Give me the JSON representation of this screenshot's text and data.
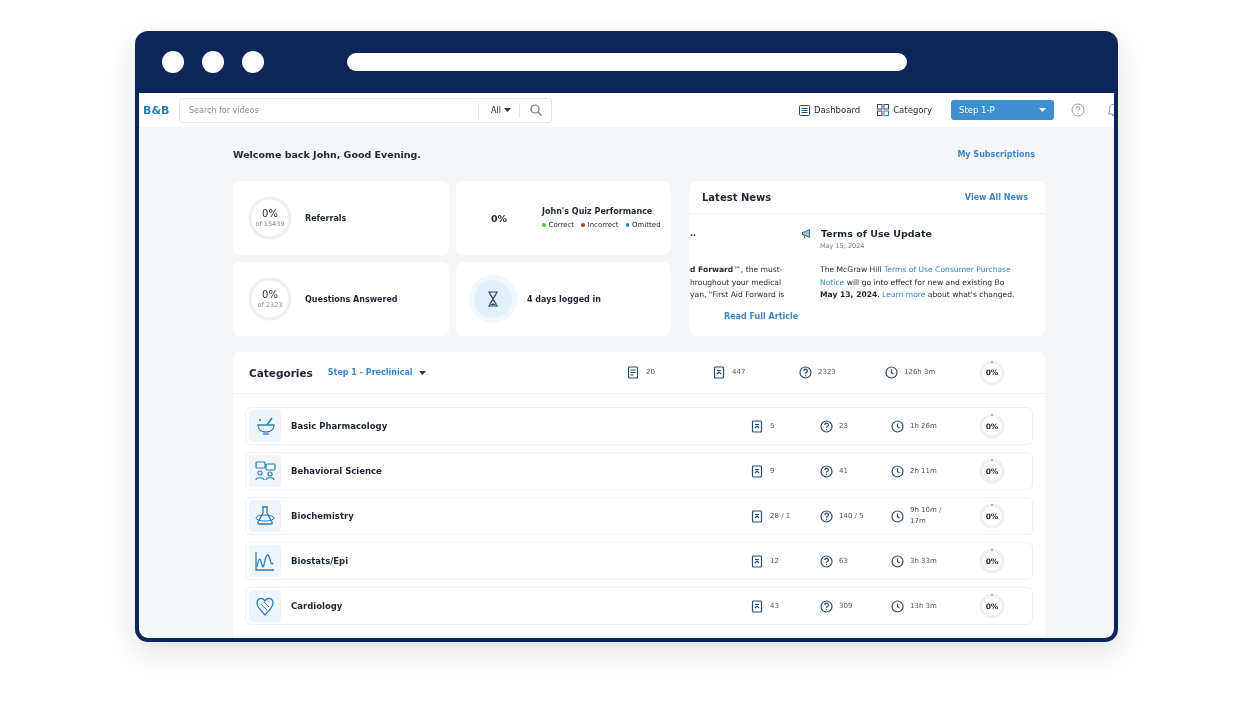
{
  "nav": {
    "logo": "B&B",
    "search": {
      "placeholder": "Search for videos",
      "filter": "All"
    },
    "links": [
      {
        "kind": "dashboard",
        "label": "Dashboard"
      },
      {
        "kind": "category",
        "label": "Category"
      }
    ],
    "step_select": "Step 1-P"
  },
  "welcome": "Welcome back John, Good Evening.",
  "subscriptions_link": "My Subscriptions",
  "stats": [
    {
      "kind": "ring",
      "value": "0%",
      "sub": "of 15439",
      "label": "Referrals"
    },
    {
      "kind": "quiz",
      "value": "0%",
      "title": "John's Quiz Performance",
      "legend": [
        {
          "label": "Correct",
          "color": "#5cc24a"
        },
        {
          "label": "Incorrect",
          "color": "#d23a3a"
        },
        {
          "label": "Omitted",
          "color": "#3b86c6"
        }
      ]
    },
    {
      "kind": "ring",
      "value": "0%",
      "sub": "of 2323",
      "label": "Questions Answered"
    },
    {
      "kind": "days",
      "label": "4 days logged in"
    }
  ],
  "news": {
    "title": "Latest News",
    "view_all": "View All News",
    "articles": [
      {
        "title": "..",
        "lines": [
          [
            {
              "kind": "bold",
              "text": "d Forward"
            },
            {
              "kind": "text",
              "text": "™, the must-"
            }
          ],
          [
            {
              "kind": "text",
              "text": "hroughout your medical"
            }
          ],
          [
            {
              "kind": "text",
              "text": "yan, \"First Aid Forward is"
            }
          ]
        ],
        "read_more": "Read Full Article"
      },
      {
        "title": "Terms of Use Update",
        "date": "May 15, 2024",
        "lines": [
          [
            {
              "kind": "text",
              "text": "The McGraw Hill "
            },
            {
              "kind": "link",
              "text": "Terms of Use Consumer Purchase"
            }
          ],
          [
            {
              "kind": "link",
              "text": "Notice"
            },
            {
              "kind": "text",
              "text": " will go into effect for new and existing Bo"
            }
          ],
          [
            {
              "kind": "bold",
              "text": "May 13, 2024"
            },
            {
              "kind": "text",
              "text": ". "
            },
            {
              "kind": "link",
              "text": "Learn more"
            },
            {
              "kind": "text",
              "text": " about what's changed."
            }
          ]
        ]
      }
    ]
  },
  "categories": {
    "title": "Categories",
    "step": "Step 1 - Preclinical",
    "totals": {
      "documents": "20",
      "books": "447",
      "questions": "2323",
      "time": "126h 3m",
      "progress": "0%"
    },
    "rows": [
      {
        "kind": "mortar",
        "name": "Basic Pharmacology",
        "books": "5",
        "questions": "23",
        "time": "1h 26m",
        "progress": "0%",
        "level": 0
      },
      {
        "kind": "people",
        "name": "Behavioral Science",
        "books": "9",
        "questions": "41",
        "time": "2h 11m",
        "progress": "0%",
        "level": 0
      },
      {
        "kind": "flask",
        "name": "Biochemistry",
        "books": "28 / 1",
        "questions": "140 / 5",
        "time": "9h 10m / 17m",
        "progress": "0%",
        "level": 0
      },
      {
        "kind": "graph",
        "name": "Biostats/Epi",
        "books": "12",
        "questions": "63",
        "time": "3h 33m",
        "progress": "0%",
        "level": 0
      },
      {
        "kind": "heart",
        "name": "Cardiology",
        "books": "43",
        "questions": "309",
        "time": "13h 3m",
        "progress": "0%",
        "level": 0
      }
    ]
  }
}
